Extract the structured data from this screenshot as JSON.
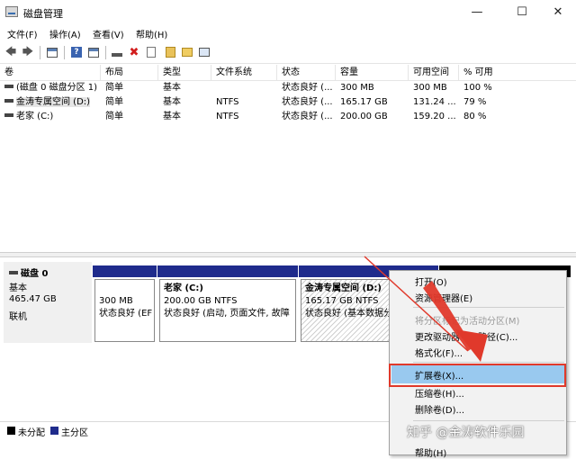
{
  "window": {
    "title": "磁盘管理",
    "minimize": "—",
    "maximize": "☐",
    "close": "✕"
  },
  "menu": [
    "文件(F)",
    "操作(A)",
    "查看(V)",
    "帮助(H)"
  ],
  "toolbar": {
    "icons": [
      "back-arrow-icon",
      "forward-arrow-icon",
      "console-tree-icon",
      "help-icon",
      "show-pane-icon",
      "connect-icon",
      "delete-icon",
      "properties-icon",
      "refresh-icon",
      "open-folder-icon",
      "view-icon"
    ],
    "back": "🡄",
    "forward": "🡆",
    "help": "?",
    "delete": "✖"
  },
  "volume_list": {
    "columns": [
      "卷",
      "布局",
      "类型",
      "文件系统",
      "状态",
      "容量",
      "可用空间",
      "% 可用"
    ],
    "rows": [
      [
        "(磁盘 0 磁盘分区 1)",
        "简单",
        "基本",
        "",
        "状态良好 (...",
        "300 MB",
        "300 MB",
        "100 %"
      ],
      [
        "金涛专属空间 (D:)",
        "简单",
        "基本",
        "NTFS",
        "状态良好 (...",
        "165.17 GB",
        "131.24 ...",
        "79 %"
      ],
      [
        "老家 (C:)",
        "简单",
        "基本",
        "NTFS",
        "状态良好 (...",
        "200.00 GB",
        "159.20 ...",
        "80 %"
      ]
    ]
  },
  "disk": {
    "name": "磁盘 0",
    "type": "基本",
    "size": "465.47 GB",
    "status": "联机"
  },
  "partitions": [
    {
      "title": "",
      "size": "300 MB",
      "status": "状态良好 (EF"
    },
    {
      "title": "老家  (C:)",
      "size": "200.00 GB NTFS",
      "status": "状态良好 (启动, 页面文件, 故障"
    },
    {
      "title": "金涛专属空间  (D:)",
      "size": "165.17 GB NTFS",
      "status": "状态良好 (基本数据分"
    }
  ],
  "legend": {
    "unallocated": "未分配",
    "primary": "主分区",
    "unallocated_color": "#000000",
    "primary_color": "#1f2b8c"
  },
  "context_menu": {
    "items": [
      {
        "label": "打开(O)",
        "disabled": false
      },
      {
        "label": "资源管理器(E)",
        "disabled": false
      },
      {
        "label": "将分区标记为活动分区(M)",
        "disabled": true
      },
      {
        "label": "更改驱动器号和路径(C)...",
        "disabled": false
      },
      {
        "label": "格式化(F)...",
        "disabled": false
      },
      {
        "label": "扩展卷(X)...",
        "disabled": false,
        "highlighted": true
      },
      {
        "label": "压缩卷(H)...",
        "disabled": false
      },
      {
        "label": "删除卷(D)...",
        "disabled": false
      },
      {
        "label": "帮助(H)",
        "disabled": false
      }
    ]
  },
  "watermark": "知乎 @金涛软件乐园",
  "colors": {
    "partition_bar": "#1f2b8c",
    "menu_highlight": "#99c9ef",
    "annotation_red": "#e0392b"
  }
}
